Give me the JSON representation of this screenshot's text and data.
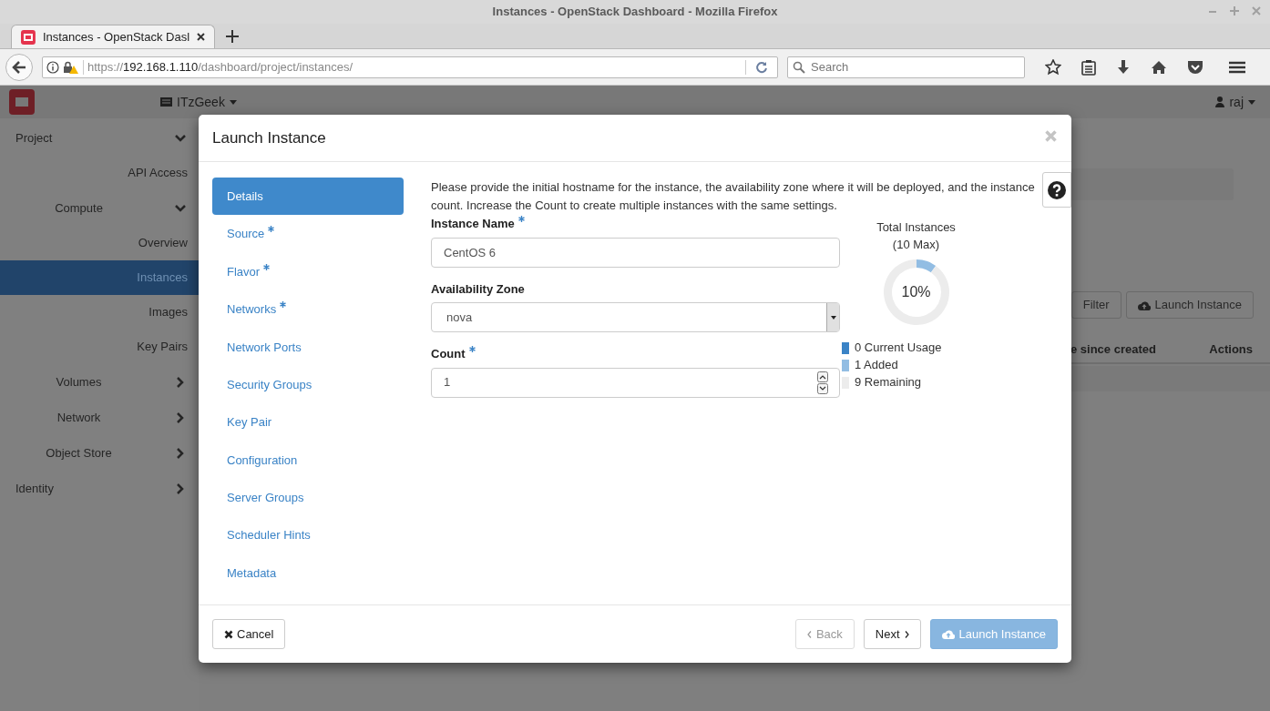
{
  "window": {
    "title": "Instances - OpenStack Dashboard - Mozilla Firefox"
  },
  "browser_tabs": [
    {
      "label": "Instances - OpenStack Dasl",
      "selected": true
    }
  ],
  "address_bar": {
    "scheme": "https://",
    "host": "192.168.1.110",
    "path": "/dashboard/project/instances/"
  },
  "search": {
    "placeholder": "Search"
  },
  "header": {
    "project": "ITzGeek",
    "user": "raj"
  },
  "sidebar": [
    {
      "label": "Project",
      "kind": "section",
      "expanded": true,
      "selected": false
    },
    {
      "label": "API Access",
      "kind": "item",
      "selected": false
    },
    {
      "label": "Compute",
      "kind": "group",
      "expanded": true,
      "selected": false
    },
    {
      "label": "Overview",
      "kind": "item",
      "selected": false
    },
    {
      "label": "Instances",
      "kind": "item",
      "selected": true
    },
    {
      "label": "Images",
      "kind": "item",
      "selected": false
    },
    {
      "label": "Key Pairs",
      "kind": "item",
      "selected": false
    },
    {
      "label": "Volumes",
      "kind": "group",
      "expanded": false,
      "selected": false
    },
    {
      "label": "Network",
      "kind": "group",
      "expanded": false,
      "selected": false
    },
    {
      "label": "Object Store",
      "kind": "group",
      "expanded": false,
      "selected": false
    },
    {
      "label": "Identity",
      "kind": "section",
      "expanded": false,
      "selected": false
    }
  ],
  "background_page": {
    "buttons": [
      "Filter",
      "Launch Instance"
    ],
    "columns": [
      "e since created",
      "Actions"
    ]
  },
  "dialog": {
    "title": "Launch Instance",
    "steps": [
      {
        "label": "Details",
        "required": false,
        "selected": true
      },
      {
        "label": "Source",
        "required": true,
        "selected": false
      },
      {
        "label": "Flavor",
        "required": true,
        "selected": false
      },
      {
        "label": "Networks",
        "required": true,
        "selected": false
      },
      {
        "label": "Network Ports",
        "required": false,
        "selected": false
      },
      {
        "label": "Security Groups",
        "required": false,
        "selected": false
      },
      {
        "label": "Key Pair",
        "required": false,
        "selected": false
      },
      {
        "label": "Configuration",
        "required": false,
        "selected": false
      },
      {
        "label": "Server Groups",
        "required": false,
        "selected": false
      },
      {
        "label": "Scheduler Hints",
        "required": false,
        "selected": false
      },
      {
        "label": "Metadata",
        "required": false,
        "selected": false
      }
    ],
    "description": "Please provide the initial hostname for the instance, the availability zone where it will be deployed, and the instance count. Increase the Count to create multiple instances with the same settings.",
    "fields": [
      {
        "label": "Instance Name",
        "required": true,
        "kind": "text",
        "value": "CentOS 6"
      },
      {
        "label": "Availability Zone",
        "required": false,
        "kind": "select",
        "value": "nova"
      },
      {
        "label": "Count",
        "required": true,
        "kind": "number",
        "value": "1"
      }
    ],
    "quota": {
      "subtitle": "(10 Max)",
      "center_label": "10%",
      "chart_data": {
        "type": "donut",
        "title": "Total Instances",
        "categories": [
          "0 Current Usage",
          "1 Added",
          "9 Remaining"
        ],
        "values": [
          0,
          10,
          90
        ]
      },
      "legend": [
        {
          "color": "#3a83c6"
        },
        {
          "color": "#92bde3"
        },
        {
          "color": "#ececec"
        }
      ]
    },
    "footer": {
      "cancel": "Cancel",
      "back": {
        "label": "Back",
        "disabled": true
      },
      "next": {
        "label": "Next",
        "disabled": false
      },
      "launch": {
        "label": "Launch Instance",
        "disabled": true
      }
    }
  }
}
